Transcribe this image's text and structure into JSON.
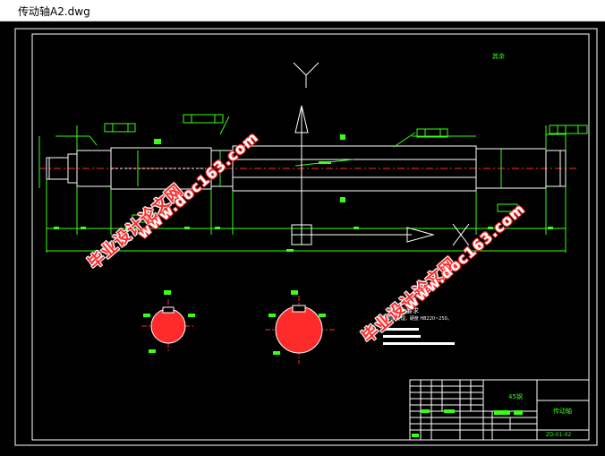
{
  "window": {
    "title": "传动轴A2.dwg"
  },
  "drawing": {
    "axis_label": "Y",
    "roughness_note": "其余",
    "tech_req_title": "技术要求",
    "tech_req_line1": "1.调质处理，硬度 HB220~250。",
    "title_block_material": "45钢",
    "title_block_name": "传动轴",
    "title_block_code": "ZD-01-02"
  },
  "watermarks": {
    "cn_text": "毕业设计论文网",
    "url_text": "www.doc163.com"
  },
  "colors": {
    "background": "#000000",
    "outline": "#ffffff",
    "dimension": "#39ff14",
    "centerline": "#ff2a2a"
  }
}
